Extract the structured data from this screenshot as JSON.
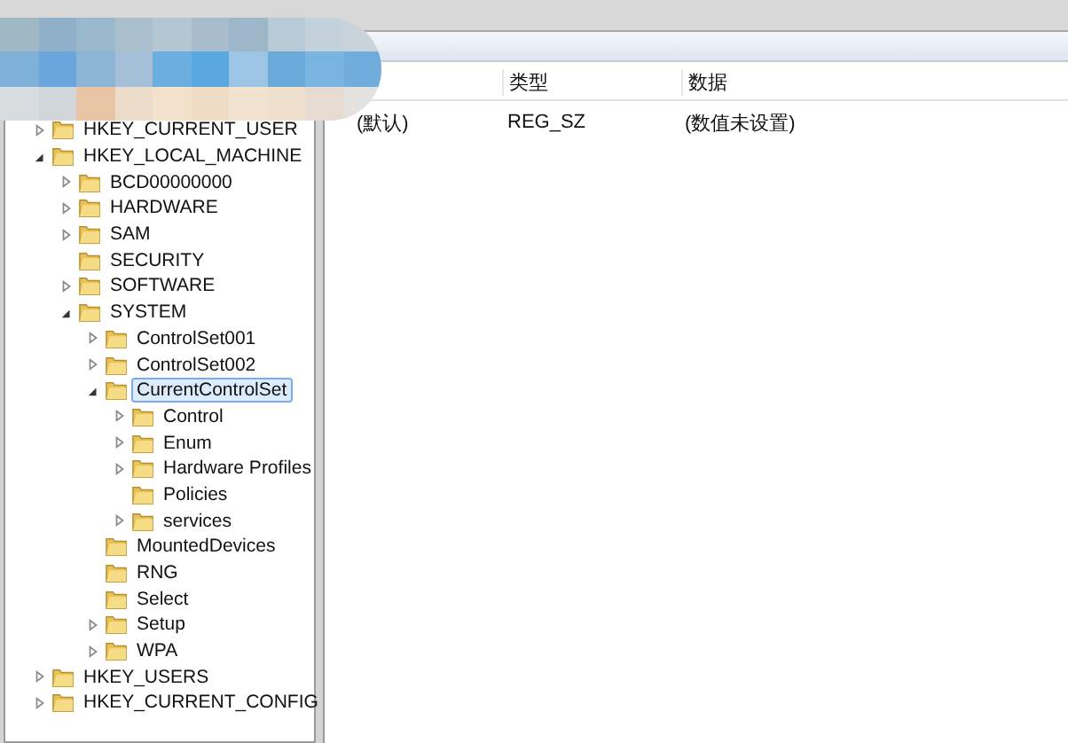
{
  "tree": [
    {
      "label": "HKEY_CURRENT_USER",
      "expanded": false,
      "selected": false
    },
    {
      "label": "HKEY_LOCAL_MACHINE",
      "expanded": true,
      "selected": false,
      "children": [
        {
          "label": "BCD00000000",
          "expanded": false,
          "selected": false
        },
        {
          "label": "HARDWARE",
          "expanded": false,
          "selected": false
        },
        {
          "label": "SAM",
          "expanded": false,
          "selected": false
        },
        {
          "label": "SECURITY",
          "selected": false
        },
        {
          "label": "SOFTWARE",
          "expanded": false,
          "selected": false
        },
        {
          "label": "SYSTEM",
          "expanded": true,
          "selected": false,
          "children": [
            {
              "label": "ControlSet001",
              "expanded": false,
              "selected": false
            },
            {
              "label": "ControlSet002",
              "expanded": false,
              "selected": false
            },
            {
              "label": "CurrentControlSet",
              "expanded": true,
              "selected": true,
              "children": [
                {
                  "label": "Control",
                  "expanded": false,
                  "selected": false
                },
                {
                  "label": "Enum",
                  "expanded": false,
                  "selected": false
                },
                {
                  "label": "Hardware Profiles",
                  "expanded": false,
                  "selected": false
                },
                {
                  "label": "Policies",
                  "selected": false
                },
                {
                  "label": "services",
                  "expanded": false,
                  "selected": false
                }
              ]
            },
            {
              "label": "MountedDevices",
              "selected": false
            },
            {
              "label": "RNG",
              "selected": false
            },
            {
              "label": "Select",
              "selected": false
            },
            {
              "label": "Setup",
              "expanded": false,
              "selected": false
            },
            {
              "label": "WPA",
              "expanded": false,
              "selected": false
            }
          ]
        }
      ]
    },
    {
      "label": "HKEY_USERS",
      "expanded": false,
      "selected": false
    },
    {
      "label": "HKEY_CURRENT_CONFIG",
      "expanded": false,
      "selected": false
    }
  ],
  "list": {
    "columns": [
      "类型",
      "数据"
    ],
    "rows": [
      {
        "name": "(默认)",
        "type": "REG_SZ",
        "data": "(数值未设置)"
      }
    ]
  }
}
